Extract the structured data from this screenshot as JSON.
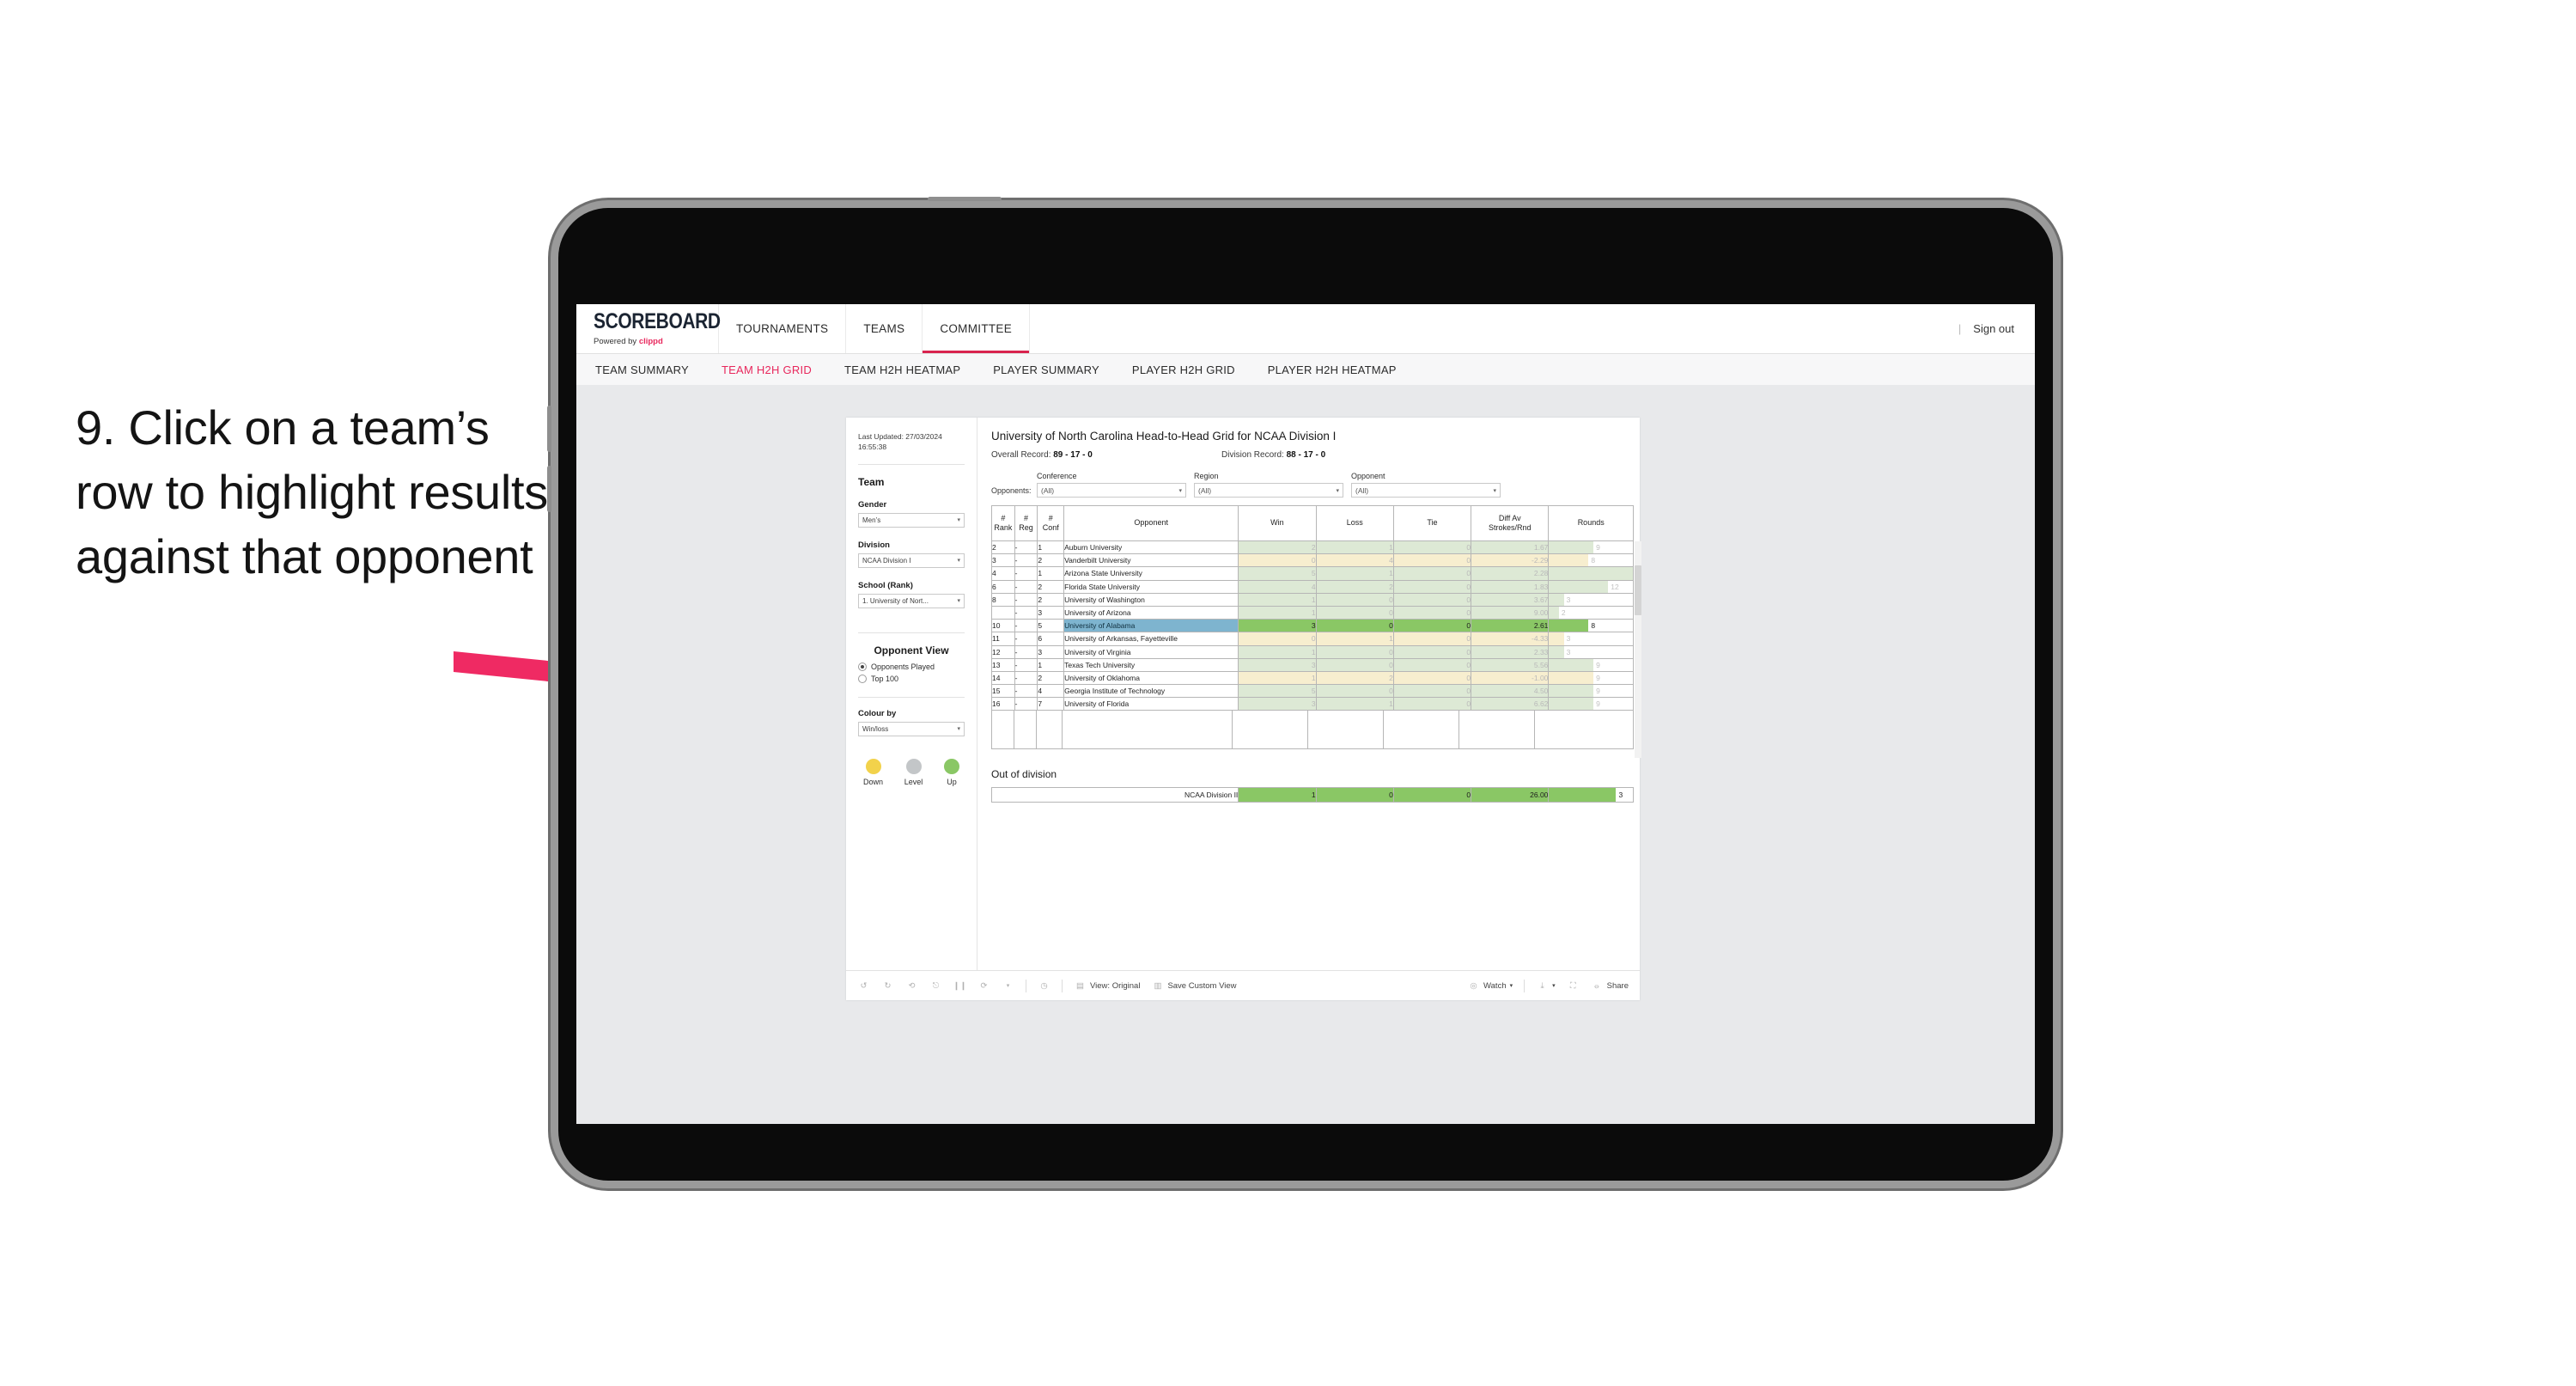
{
  "annotation": {
    "step_text": "9. Click on a team’s row to highlight results against that opponent",
    "arrow_color": "#ef2a63"
  },
  "app": {
    "logo": {
      "word": "SCOREBOARD",
      "powered_prefix": "Powered by ",
      "powered_brand": "clippd"
    },
    "top_nav": [
      {
        "label": "TOURNAMENTS",
        "active": false
      },
      {
        "label": "TEAMS",
        "active": false
      },
      {
        "label": "COMMITTEE",
        "active": true
      }
    ],
    "sign_out": {
      "divider": "|",
      "label": "Sign out"
    },
    "sub_nav": [
      {
        "label": "TEAM SUMMARY",
        "active": false
      },
      {
        "label": "TEAM H2H GRID",
        "active": true
      },
      {
        "label": "TEAM H2H HEATMAP",
        "active": false
      },
      {
        "label": "PLAYER SUMMARY",
        "active": false
      },
      {
        "label": "PLAYER H2H GRID",
        "active": false
      },
      {
        "label": "PLAYER H2H HEATMAP",
        "active": false
      }
    ],
    "accent_color": "#e8275c"
  },
  "panel": {
    "last_updated": "Last Updated: 27/03/2024 16:55:38",
    "team_title": "Team",
    "gender": {
      "label": "Gender",
      "value": "Men’s"
    },
    "division": {
      "label": "Division",
      "value": "NCAA Division I"
    },
    "school": {
      "label": "School (Rank)",
      "value": "1. University of Nort..."
    },
    "opponent_view": {
      "title": "Opponent View",
      "options": [
        {
          "label": "Opponents Played",
          "selected": true
        },
        {
          "label": "Top 100",
          "selected": false
        }
      ]
    },
    "colour_by": {
      "label": "Colour by",
      "value": "Win/loss"
    },
    "legend": [
      {
        "label": "Down",
        "color": "#f2d24b"
      },
      {
        "label": "Level",
        "color": "#c3c6c8"
      },
      {
        "label": "Up",
        "color": "#8ac765"
      }
    ]
  },
  "viz": {
    "title": "University of North Carolina Head-to-Head Grid for NCAA Division I",
    "overall_record_label": "Overall Record:",
    "overall_record_value": "89 - 17 - 0",
    "division_record_label": "Division Record:",
    "division_record_value": "88 - 17 - 0",
    "opponents_label": "Opponents:",
    "filters": [
      {
        "label": "Conference",
        "value": "(All)"
      },
      {
        "label": "Region",
        "value": "(All)"
      },
      {
        "label": "Opponent",
        "value": "(All)"
      }
    ],
    "columns": [
      "# Rank",
      "# Reg",
      "# Conf",
      "Opponent",
      "Win",
      "Loss",
      "Tie",
      "Diff Av Strokes/Rnd",
      "Rounds"
    ],
    "out_of_division_title": "Out of division",
    "out_of_division_row": {
      "label": "NCAA Division II",
      "win": "1",
      "loss": "0",
      "tie": "0",
      "diff": "26.00",
      "rounds": "3"
    }
  },
  "chart_data": {
    "type": "table",
    "title": "University of North Carolina Head-to-Head Grid for NCAA Division I",
    "columns": [
      "# Rank",
      "# Reg",
      "# Conf",
      "Opponent",
      "Win",
      "Loss",
      "Tie",
      "Diff Av Strokes/Rnd",
      "Rounds"
    ],
    "rounds_max": 17,
    "colors": {
      "up": "#dde9d5",
      "down": "#f7eecf",
      "selected_opponent": "#7eb4cf",
      "selected_cells": "#8ac765"
    },
    "rows": [
      {
        "rank": "2",
        "reg": "-",
        "conf": "1",
        "opponent": "Auburn University",
        "win": "2",
        "loss": "1",
        "tie": "0",
        "diff": "1.67",
        "rounds": 9,
        "tone": "up",
        "selected": false
      },
      {
        "rank": "3",
        "reg": "-",
        "conf": "2",
        "opponent": "Vanderbilt University",
        "win": "0",
        "loss": "4",
        "tie": "0",
        "diff": "-2.29",
        "rounds": 8,
        "tone": "down",
        "selected": false
      },
      {
        "rank": "4",
        "reg": "-",
        "conf": "1",
        "opponent": "Arizona State University",
        "win": "5",
        "loss": "1",
        "tie": "0",
        "diff": "2.28",
        "rounds": 17,
        "tone": "up",
        "selected": false
      },
      {
        "rank": "6",
        "reg": "-",
        "conf": "2",
        "opponent": "Florida State University",
        "win": "4",
        "loss": "2",
        "tie": "0",
        "diff": "1.83",
        "rounds": 12,
        "tone": "up",
        "selected": false
      },
      {
        "rank": "8",
        "reg": "-",
        "conf": "2",
        "opponent": "University of Washington",
        "win": "1",
        "loss": "0",
        "tie": "0",
        "diff": "3.67",
        "rounds": 3,
        "tone": "up",
        "selected": false
      },
      {
        "rank": "",
        "reg": "-",
        "conf": "3",
        "opponent": "University of Arizona",
        "win": "1",
        "loss": "0",
        "tie": "0",
        "diff": "9.00",
        "rounds": 2,
        "tone": "up",
        "selected": false
      },
      {
        "rank": "10",
        "reg": "-",
        "conf": "5",
        "opponent": "University of Alabama",
        "win": "3",
        "loss": "0",
        "tie": "0",
        "diff": "2.61",
        "rounds": 8,
        "tone": "up",
        "selected": true
      },
      {
        "rank": "11",
        "reg": "-",
        "conf": "6",
        "opponent": "University of Arkansas, Fayetteville",
        "win": "0",
        "loss": "1",
        "tie": "0",
        "diff": "-4.33",
        "rounds": 3,
        "tone": "down",
        "selected": false
      },
      {
        "rank": "12",
        "reg": "-",
        "conf": "3",
        "opponent": "University of Virginia",
        "win": "1",
        "loss": "0",
        "tie": "0",
        "diff": "2.33",
        "rounds": 3,
        "tone": "up",
        "selected": false
      },
      {
        "rank": "13",
        "reg": "-",
        "conf": "1",
        "opponent": "Texas Tech University",
        "win": "3",
        "loss": "0",
        "tie": "0",
        "diff": "5.56",
        "rounds": 9,
        "tone": "up",
        "selected": false
      },
      {
        "rank": "14",
        "reg": "-",
        "conf": "2",
        "opponent": "University of Oklahoma",
        "win": "1",
        "loss": "2",
        "tie": "0",
        "diff": "-1.00",
        "rounds": 9,
        "tone": "down",
        "selected": false
      },
      {
        "rank": "15",
        "reg": "-",
        "conf": "4",
        "opponent": "Georgia Institute of Technology",
        "win": "5",
        "loss": "0",
        "tie": "0",
        "diff": "4.50",
        "rounds": 9,
        "tone": "up",
        "selected": false
      },
      {
        "rank": "16",
        "reg": "-",
        "conf": "7",
        "opponent": "University of Florida",
        "win": "3",
        "loss": "1",
        "tie": "0",
        "diff": "6.62",
        "rounds": 9,
        "tone": "up",
        "selected": false
      }
    ]
  },
  "toolbar": {
    "view_label": "View: Original",
    "save_label": "Save Custom View",
    "watch_label": "Watch",
    "share_label": "Share"
  }
}
